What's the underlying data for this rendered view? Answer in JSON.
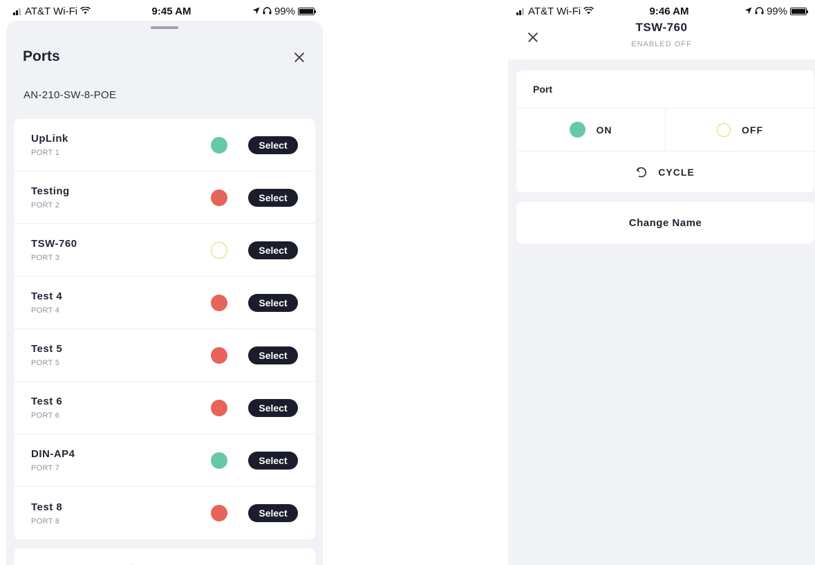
{
  "left_screen": {
    "status": {
      "carrier": "AT&T Wi-Fi",
      "time": "9:45 AM",
      "battery": "99%"
    },
    "title": "Ports",
    "device": "AN-210-SW-8-POE",
    "ports": [
      {
        "name": "UpLink",
        "port": "PORT 1",
        "status": "on"
      },
      {
        "name": "Testing",
        "port": "PORT 2",
        "status": "error"
      },
      {
        "name": "TSW-760",
        "port": "PORT 3",
        "status": "off"
      },
      {
        "name": "Test 4",
        "port": "PORT 4",
        "status": "error"
      },
      {
        "name": "Test 5",
        "port": "PORT 5",
        "status": "error"
      },
      {
        "name": "Test 6",
        "port": "PORT 6",
        "status": "error"
      },
      {
        "name": "DIN-AP4",
        "port": "PORT 7",
        "status": "on"
      },
      {
        "name": "Test 8",
        "port": "PORT 8",
        "status": "error"
      }
    ],
    "select_label": "Select"
  },
  "right_screen": {
    "status": {
      "carrier": "AT&T Wi-Fi",
      "time": "9:46 AM",
      "battery": "99%"
    },
    "title": "TSW-760",
    "subtitle": "ENABLED OFF",
    "port_label": "Port",
    "on_label": "ON",
    "off_label": "OFF",
    "cycle_label": "CYCLE",
    "change_name_label": "Change Name"
  },
  "colors": {
    "on": "#66c8a8",
    "error": "#e8635a",
    "off_ring": "#ecd65b",
    "button_bg": "#1b1d2c"
  }
}
